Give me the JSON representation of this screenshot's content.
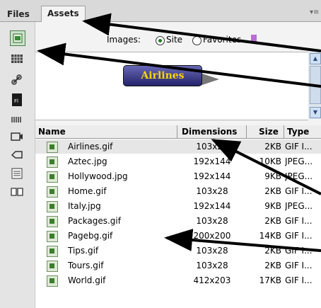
{
  "tabs": [
    {
      "label": "Files",
      "active": false
    },
    {
      "label": "Assets",
      "active": true
    }
  ],
  "panel_menu_icon": "panel-options-icon",
  "sidebar": {
    "categories": [
      {
        "name": "images",
        "icon": "image-icon",
        "active": true
      },
      {
        "name": "colors",
        "icon": "color-swatch-icon",
        "active": false
      },
      {
        "name": "urls",
        "icon": "link-icon",
        "active": false
      },
      {
        "name": "flash",
        "icon": "flash-icon",
        "text": "Fl",
        "active": false
      },
      {
        "name": "shockwave",
        "icon": "shockwave-icon",
        "active": false
      },
      {
        "name": "movies",
        "icon": "movie-icon",
        "active": false
      },
      {
        "name": "scripts",
        "icon": "script-icon",
        "active": false
      },
      {
        "name": "templates",
        "icon": "template-icon",
        "active": false
      },
      {
        "name": "library",
        "icon": "library-icon",
        "active": false
      }
    ]
  },
  "filter": {
    "label": "Images:",
    "options": [
      {
        "label": "Site",
        "selected": true
      },
      {
        "label": "Favorites",
        "selected": false
      }
    ]
  },
  "preview": {
    "image_text": "Airlines"
  },
  "list": {
    "columns": [
      "Name",
      "Dimensions",
      "Size",
      "Type"
    ],
    "rows": [
      {
        "name": "Airlines.gif",
        "dimensions": "103x28",
        "size": "2KB",
        "type": "GIF I...",
        "selected": true
      },
      {
        "name": "Aztec.jpg",
        "dimensions": "192x144",
        "size": "10KB",
        "type": "JPEG..."
      },
      {
        "name": "Hollywood.jpg",
        "dimensions": "192x144",
        "size": "9KB",
        "type": "JPEG..."
      },
      {
        "name": "Home.gif",
        "dimensions": "103x28",
        "size": "2KB",
        "type": "GIF I..."
      },
      {
        "name": "Italy.jpg",
        "dimensions": "192x144",
        "size": "9KB",
        "type": "JPEG..."
      },
      {
        "name": "Packages.gif",
        "dimensions": "103x28",
        "size": "2KB",
        "type": "GIF I..."
      },
      {
        "name": "Pagebg.gif",
        "dimensions": "200x200",
        "size": "14KB",
        "type": "GIF I..."
      },
      {
        "name": "Tips.gif",
        "dimensions": "103x28",
        "size": "2KB",
        "type": "GIF I..."
      },
      {
        "name": "Tours.gif",
        "dimensions": "103x28",
        "size": "2KB",
        "type": "GIF I..."
      },
      {
        "name": "World.gif",
        "dimensions": "412x203",
        "size": "17KB",
        "type": "GIF I..."
      }
    ]
  }
}
